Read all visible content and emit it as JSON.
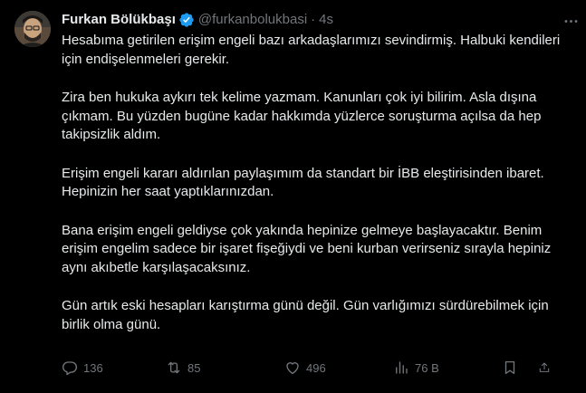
{
  "author": {
    "name": "Furkan Bölükbaşı",
    "handle": "@furkanbolukbasi",
    "separator": "·",
    "time": "4s"
  },
  "paragraphs": [
    "Hesabıma getirilen erişim engeli bazı arkadaşlarımızı sevindirmiş. Halbuki kendileri için endişelenmeleri gerekir.",
    "Zira ben hukuka aykırı tek kelime yazmam. Kanunları çok iyi bilirim. Asla dışına çıkmam. Bu yüzden bugüne kadar hakkımda yüzlerce soruşturma açılsa da hep takipsizlik aldım.",
    "Erişim engeli kararı aldırılan paylaşımım da standart bir İBB eleştirisinden ibaret. Hepinizin her saat yaptıklarınızdan.",
    "Bana erişim engeli geldiyse çok yakında hepinize gelmeye başlayacaktır. Benim erişim engelim sadece bir işaret fişeğiydi ve beni kurban verirseniz sırayla hepiniz aynı akıbetle karşılaşacaksınız.",
    "Gün artık eski hesapları karıştırma günü değil. Gün varlığımızı sürdürebilmek için birlik olma günü."
  ],
  "stats": {
    "replies": "136",
    "reposts": "85",
    "likes": "496",
    "views": "76 B"
  },
  "colors": {
    "background": "#000000",
    "text": "#e7e9ea",
    "muted": "#71767b",
    "verified": "#1d9bf0"
  },
  "icons": [
    "verified-badge-icon",
    "more-icon",
    "reply-icon",
    "repost-icon",
    "like-icon",
    "views-icon",
    "bookmark-icon",
    "share-icon"
  ]
}
